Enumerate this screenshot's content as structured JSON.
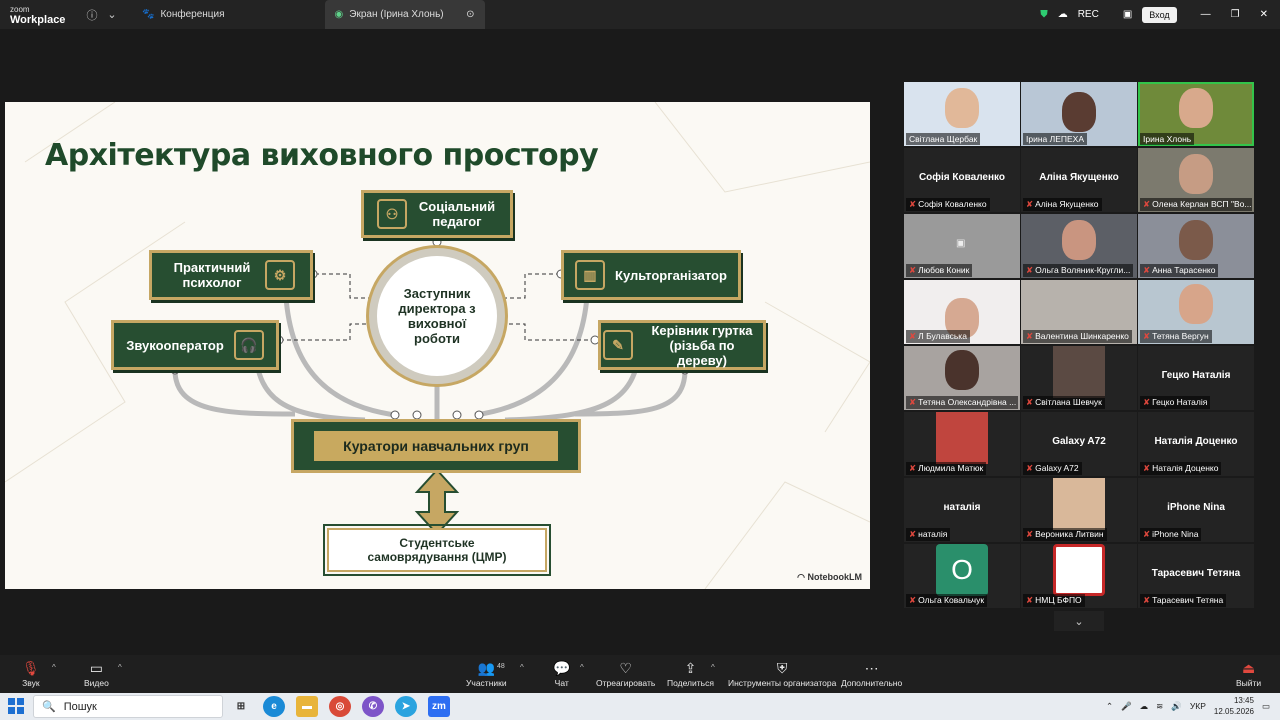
{
  "app": {
    "logo_line1": "zoom",
    "logo_line2": "Workplace"
  },
  "tabs": [
    {
      "label": "Конференция"
    },
    {
      "label": "Экран (Ірина Хлонь)"
    }
  ],
  "topbar": {
    "rec_label": "REC",
    "signin_label": "Вход"
  },
  "slide": {
    "title": "Архітектура виховного простору",
    "hub": "Заступник директора з виховної роботи",
    "nodes": {
      "social": "Соціальний педагог",
      "psych": "Практичний психолог",
      "culture": "Культорганізатор",
      "sound": "Звукооператор",
      "club": "Керівник гуртка (різьба по дереву)"
    },
    "curators": "Куратори навчальних груп",
    "students": "Студентське самоврядування (ЦМР)",
    "watermark": "NotebookLM"
  },
  "participants": [
    {
      "name": "Світлана Щербак",
      "big": ""
    },
    {
      "name": "Ірина ЛЕПЕХА",
      "big": ""
    },
    {
      "name": "Ірина Хлонь",
      "big": ""
    },
    {
      "name": "Софія Коваленко",
      "big": "Софія Коваленко"
    },
    {
      "name": "Аліна Якущенко",
      "big": "Аліна Якущенко"
    },
    {
      "name": "Олена Керлан ВСП \"Во...",
      "big": ""
    },
    {
      "name": "Любов Коник",
      "big": ""
    },
    {
      "name": "Ольга Воляник-Кругли...",
      "big": ""
    },
    {
      "name": "Анна Тарасенко",
      "big": ""
    },
    {
      "name": "Л Булавська",
      "big": ""
    },
    {
      "name": "Валентина Шинкаренко",
      "big": ""
    },
    {
      "name": "Тетяна Вергун",
      "big": ""
    },
    {
      "name": "Тетяна Олександрівна ...",
      "big": ""
    },
    {
      "name": "Світлана Шевчук",
      "big": ""
    },
    {
      "name": "Гецко Наталія",
      "big": "Гецко Наталія"
    },
    {
      "name": "Людмила Матюк",
      "big": ""
    },
    {
      "name": "Galaxy A72",
      "big": "Galaxy A72"
    },
    {
      "name": "Наталія Доценко",
      "big": "Наталія Доценко"
    },
    {
      "name": "наталія",
      "big": "наталія"
    },
    {
      "name": "Вероника Литвин",
      "big": ""
    },
    {
      "name": "iPhone Nina",
      "big": "iPhone Nina"
    },
    {
      "name": "Ольга Ковальчук",
      "big": "",
      "avatar": "O"
    },
    {
      "name": "НМЦ БФПО",
      "big": ""
    },
    {
      "name": "Тарасевич Тетяна",
      "big": "Тарасевич Тетяна"
    }
  ],
  "toolbar": {
    "audio": "Звук",
    "video": "Видео",
    "participants": "Участники",
    "participants_count": "48",
    "chat": "Чат",
    "react": "Отреагировать",
    "share": "Поделиться",
    "host_tools": "Инструменты организатора",
    "more": "Дополнительно",
    "leave": "Выйти"
  },
  "taskbar": {
    "search_placeholder": "Пошук",
    "lang": "УКР",
    "time": "13:45",
    "date": "12.05.2026"
  },
  "colors": {
    "slide_green": "#274e31",
    "slide_gold": "#c6a763",
    "mic_muted": "#e0483e",
    "speaking": "#33c44a"
  }
}
